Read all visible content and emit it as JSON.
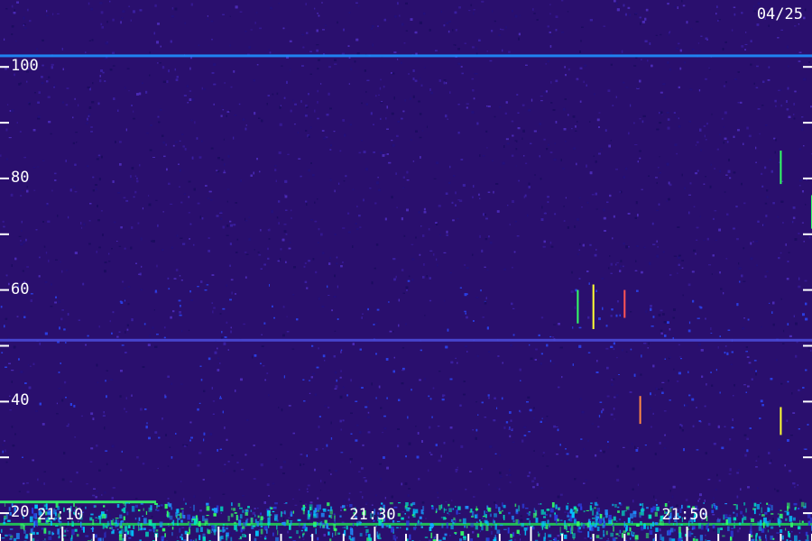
{
  "date_label": "04/25",
  "chart_data": {
    "type": "heatmap",
    "title": "",
    "xlabel": "",
    "ylabel": "",
    "x_range": [
      "21:06",
      "21:58"
    ],
    "x_tick_labels": [
      "21:10",
      "21:30",
      "21:50"
    ],
    "x_tick_values_minutes": [
      1270,
      1290,
      1310
    ],
    "y_range": [
      15,
      112
    ],
    "y_tick_labels": [
      "20",
      "40",
      "60",
      "80",
      "100"
    ],
    "y_tick_values": [
      20,
      40,
      60,
      80,
      100
    ],
    "y_minor_ticks": [
      30,
      50,
      70,
      90
    ],
    "colormap": [
      "#2a0f6e",
      "#3a1fa0",
      "#1f3cff",
      "#00c8ff",
      "#33ff66",
      "#ffff33",
      "#ff3333"
    ],
    "features": [
      {
        "kind": "horizontal_line",
        "frequency": 102,
        "color": "#1f8fff"
      },
      {
        "kind": "horizontal_line",
        "frequency": 51,
        "color": "#4a4ad8"
      },
      {
        "kind": "horizontal_line",
        "frequency": 22,
        "time_start": "21:06",
        "time_end": "21:16",
        "color": "#33ff66"
      },
      {
        "kind": "horizontal_line",
        "frequency": 18,
        "color": "#22cc55"
      },
      {
        "kind": "noise_band",
        "frequency_min": 15,
        "frequency_max": 22,
        "color": "#00c8ff"
      },
      {
        "kind": "vertical_streak",
        "time": "21:46",
        "freq_min": 55,
        "freq_max": 60,
        "color": "#ff5555"
      },
      {
        "kind": "vertical_streak",
        "time": "21:43",
        "freq_min": 54,
        "freq_max": 60,
        "color": "#33ff66"
      },
      {
        "kind": "vertical_streak",
        "time": "21:44",
        "freq_min": 53,
        "freq_max": 61,
        "color": "#ffff33"
      },
      {
        "kind": "vertical_streak",
        "time": "21:56",
        "freq_min": 79,
        "freq_max": 85,
        "color": "#33ff66"
      },
      {
        "kind": "vertical_streak",
        "time": "21:58",
        "freq_min": 71,
        "freq_max": 77,
        "color": "#33ff66"
      },
      {
        "kind": "vertical_streak",
        "time": "21:56",
        "freq_min": 34,
        "freq_max": 39,
        "color": "#ffff33"
      },
      {
        "kind": "vertical_streak",
        "time": "21:47",
        "freq_min": 36,
        "freq_max": 41,
        "color": "#ff8844"
      }
    ]
  }
}
